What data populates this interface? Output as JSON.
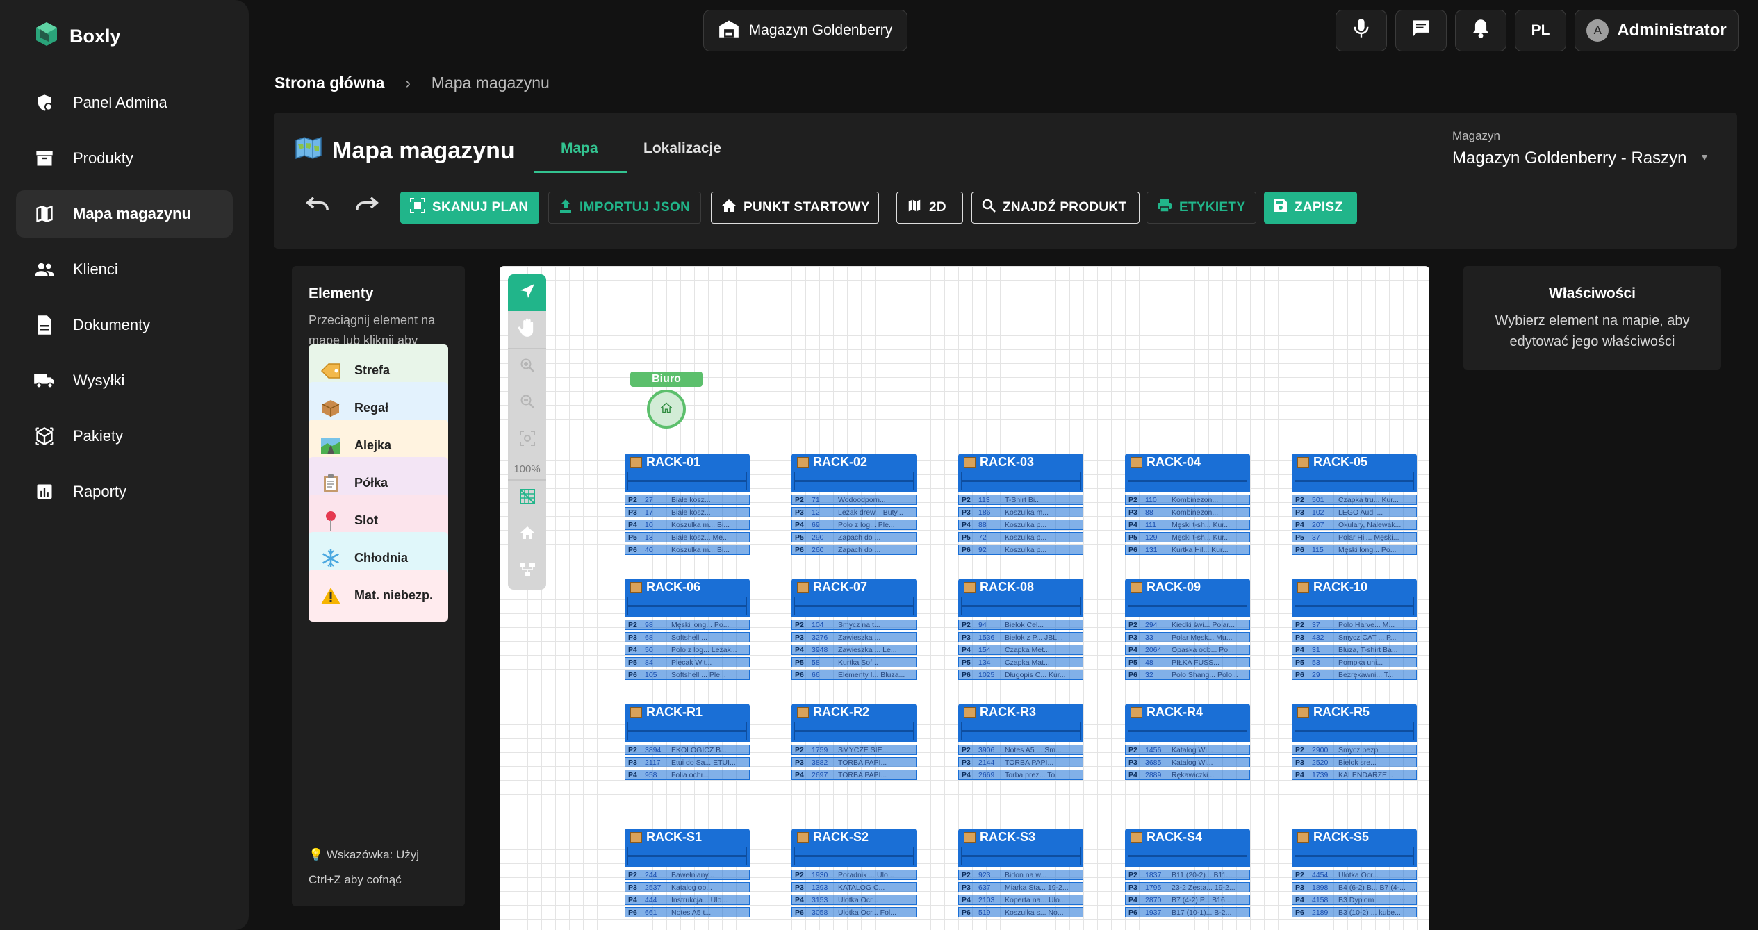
{
  "app": {
    "name": "Boxly"
  },
  "sidebar": {
    "items": [
      {
        "label": "Panel Admina",
        "icon": "admin-shield-icon"
      },
      {
        "label": "Produkty",
        "icon": "archive-box-icon"
      },
      {
        "label": "Mapa magazynu",
        "icon": "map-icon",
        "active": true
      },
      {
        "label": "Klienci",
        "icon": "people-icon"
      },
      {
        "label": "Dokumenty",
        "icon": "document-icon"
      },
      {
        "label": "Wysyłki",
        "icon": "truck-icon"
      },
      {
        "label": "Pakiety",
        "icon": "package-icon"
      },
      {
        "label": "Raporty",
        "icon": "chart-icon"
      }
    ]
  },
  "topbar": {
    "warehouse": "Magazyn Goldenberry",
    "language": "PL",
    "user_initial": "A",
    "user_name": "Administrator"
  },
  "breadcrumb": {
    "home": "Strona główna",
    "current": "Mapa magazynu"
  },
  "header": {
    "title": "Mapa magazynu",
    "tabs": [
      {
        "label": "Mapa",
        "active": true
      },
      {
        "label": "Lokalizacje",
        "active": false
      }
    ],
    "warehouse_select": {
      "label": "Magazyn",
      "value": "Magazyn Goldenberry - Raszyn"
    }
  },
  "toolbar": {
    "scan": "SKANUJ PLAN",
    "import": "IMPORTUJ JSON",
    "start": "PUNKT STARTOWY",
    "view": "2D",
    "find": "ZNAJDŹ PRODUKT",
    "labels": "ETYKIETY",
    "save": "ZAPISZ"
  },
  "elements_panel": {
    "title": "Elementy",
    "description": "Przeciągnij element na mapę lub kliknij aby dodać",
    "items": [
      {
        "label": "Strefa",
        "bg": "#e8f5e9",
        "icon": "tag-icon"
      },
      {
        "label": "Regał",
        "bg": "#e3f2fd",
        "icon": "box-icon"
      },
      {
        "label": "Alejka",
        "bg": "#fff3e0",
        "icon": "road-icon"
      },
      {
        "label": "Półka",
        "bg": "#f3e5f5",
        "icon": "clipboard-icon"
      },
      {
        "label": "Slot",
        "bg": "#fce4ec",
        "icon": "pin-icon"
      },
      {
        "label": "Chłodnia",
        "bg": "#e0f7fa",
        "icon": "snowflake-icon"
      },
      {
        "label": "Mat. niebezp.",
        "bg": "#ffebee",
        "icon": "warning-icon"
      }
    ],
    "hint": "💡 Wskazówka: Użyj Ctrl+Z aby cofnąć"
  },
  "map": {
    "zoom": "100%",
    "office_label": "Biuro",
    "racks": [
      {
        "name": "RACK-01",
        "rows": [
          [
            "P2",
            "27",
            "Białe kosz..."
          ],
          [
            "P3",
            "17",
            "Białe kosz..."
          ],
          [
            "P4",
            "10",
            "Koszulka m... Bi..."
          ],
          [
            "P5",
            "13",
            "Białe kosz... Me..."
          ],
          [
            "P6",
            "40",
            "Koszulka m... Bi..."
          ]
        ]
      },
      {
        "name": "RACK-02",
        "rows": [
          [
            "P2",
            "71",
            "Wodoodporn..."
          ],
          [
            "P3",
            "12",
            "Lezak drew... Buty..."
          ],
          [
            "P4",
            "69",
            "Polo z log... Ple..."
          ],
          [
            "P5",
            "290",
            "Zapach do ..."
          ],
          [
            "P6",
            "260",
            "Zapach do ..."
          ]
        ]
      },
      {
        "name": "RACK-03",
        "rows": [
          [
            "P2",
            "113",
            "T-Shirt Bi..."
          ],
          [
            "P3",
            "186",
            "Koszulka m..."
          ],
          [
            "P4",
            "88",
            "Koszulka p..."
          ],
          [
            "P5",
            "72",
            "Koszulka p..."
          ],
          [
            "P6",
            "92",
            "Koszulka p..."
          ]
        ]
      },
      {
        "name": "RACK-04",
        "rows": [
          [
            "P2",
            "110",
            "Kombinezon..."
          ],
          [
            "P3",
            "88",
            "Kombinezon..."
          ],
          [
            "P4",
            "111",
            "Męski t-sh... Kur..."
          ],
          [
            "P5",
            "129",
            "Męski t-sh... Kur..."
          ],
          [
            "P6",
            "131",
            "Kurtka Hil... Kur..."
          ]
        ]
      },
      {
        "name": "RACK-05",
        "rows": [
          [
            "P2",
            "501",
            "Czapka tru... Kur..."
          ],
          [
            "P3",
            "102",
            "LEGO Audi ..."
          ],
          [
            "P4",
            "207",
            "Okulary, Nalewak..."
          ],
          [
            "P5",
            "37",
            "Polar Hil... Męski..."
          ],
          [
            "P6",
            "115",
            "Męski long... Po..."
          ]
        ]
      },
      {
        "name": "RACK-06",
        "rows": [
          [
            "P2",
            "98",
            "Męski long... Po..."
          ],
          [
            "P3",
            "68",
            "Softshell ..."
          ],
          [
            "P4",
            "50",
            "Polo z log... Leżak..."
          ],
          [
            "P5",
            "84",
            "Plecak Wit..."
          ],
          [
            "P6",
            "105",
            "Softshell ... Ple..."
          ]
        ]
      },
      {
        "name": "RACK-07",
        "rows": [
          [
            "P2",
            "104",
            "Smycz na t..."
          ],
          [
            "P3",
            "3276",
            "Zawieszka ..."
          ],
          [
            "P4",
            "3948",
            "Zawieszka ... Le..."
          ],
          [
            "P5",
            "58",
            "Kurtka Sof..."
          ],
          [
            "P6",
            "66",
            "Elementy I... Bluza..."
          ]
        ]
      },
      {
        "name": "RACK-08",
        "rows": [
          [
            "P2",
            "94",
            "Bielok Cel..."
          ],
          [
            "P3",
            "1536",
            "Bielok z P... JBL..."
          ],
          [
            "P4",
            "154",
            "Czapka Met..."
          ],
          [
            "P5",
            "134",
            "Czapka Mat..."
          ],
          [
            "P6",
            "1025",
            "Długopis C... Kur..."
          ]
        ]
      },
      {
        "name": "RACK-09",
        "rows": [
          [
            "P2",
            "294",
            "Kiedki świ... Polar..."
          ],
          [
            "P3",
            "33",
            "Polar Męsk... Mu..."
          ],
          [
            "P4",
            "2064",
            "Opaska odb... Po..."
          ],
          [
            "P5",
            "48",
            "PIŁKA FUSS..."
          ],
          [
            "P6",
            "32",
            "Polo Shang... Polo..."
          ]
        ]
      },
      {
        "name": "RACK-10",
        "rows": [
          [
            "P2",
            "37",
            "Polo Harve... M..."
          ],
          [
            "P3",
            "432",
            "Smycz CAT ... P..."
          ],
          [
            "P4",
            "31",
            "Bluza, T-shirt Ba..."
          ],
          [
            "P5",
            "53",
            "Pompka uni..."
          ],
          [
            "P6",
            "29",
            "Bezrękawni... T..."
          ]
        ]
      },
      {
        "name": "RACK-R1",
        "rows": [
          [
            "P2",
            "3894",
            "EKOLOGICZ B..."
          ],
          [
            "P3",
            "2117",
            "Etui do Sa... ETUI..."
          ],
          [
            "P4",
            "958",
            "Folia ochr..."
          ]
        ]
      },
      {
        "name": "RACK-R2",
        "rows": [
          [
            "P2",
            "1759",
            "SMYCZE SIE..."
          ],
          [
            "P3",
            "3882",
            "TORBA PAPI..."
          ],
          [
            "P4",
            "2697",
            "TORBA PAPI..."
          ]
        ]
      },
      {
        "name": "RACK-R3",
        "rows": [
          [
            "P2",
            "3906",
            "Notes A5 ... Sm..."
          ],
          [
            "P3",
            "2144",
            "TORBA PAPI..."
          ],
          [
            "P4",
            "2669",
            "Torba prez... To..."
          ]
        ]
      },
      {
        "name": "RACK-R4",
        "rows": [
          [
            "P2",
            "1456",
            "Katalog Wi..."
          ],
          [
            "P3",
            "3685",
            "Katalog Wi..."
          ],
          [
            "P4",
            "2889",
            "Rękawiczki..."
          ]
        ]
      },
      {
        "name": "RACK-R5",
        "rows": [
          [
            "P2",
            "2900",
            "Smycz bezp..."
          ],
          [
            "P3",
            "2520",
            "Bielok sre..."
          ],
          [
            "P4",
            "1739",
            "KALENDARZE..."
          ]
        ]
      },
      {
        "name": "RACK-S1",
        "rows": [
          [
            "P2",
            "244",
            "Bawełniany..."
          ],
          [
            "P3",
            "2537",
            "Katalog ob..."
          ],
          [
            "P4",
            "444",
            "Instrukcja... Ulo..."
          ],
          [
            "P6",
            "661",
            "Notes A5 t..."
          ]
        ]
      },
      {
        "name": "RACK-S2",
        "rows": [
          [
            "P2",
            "1930",
            "Poradnik ... Ulo..."
          ],
          [
            "P3",
            "1393",
            "KATALOG C..."
          ],
          [
            "P4",
            "3153",
            "Ulotka Ocr..."
          ],
          [
            "P6",
            "3058",
            "Ulotka Ocr... Fol..."
          ]
        ]
      },
      {
        "name": "RACK-S3",
        "rows": [
          [
            "P2",
            "923",
            "Bidon na w..."
          ],
          [
            "P3",
            "637",
            "Miarka Sta... 19-2..."
          ],
          [
            "P4",
            "2103",
            "Koperta na... Ulo..."
          ],
          [
            "P6",
            "519",
            "Koszulka s... No..."
          ]
        ]
      },
      {
        "name": "RACK-S4",
        "rows": [
          [
            "P2",
            "1837",
            "B11 (20-2)... B11..."
          ],
          [
            "P3",
            "1795",
            "23-2 Zesta... 19-2..."
          ],
          [
            "P4",
            "2870",
            "B7 (4-2) P... B16..."
          ],
          [
            "P6",
            "1937",
            "B17 (10-1)... B-2..."
          ]
        ]
      },
      {
        "name": "RACK-S5",
        "rows": [
          [
            "P2",
            "4454",
            "Ulotka Ocr..."
          ],
          [
            "P3",
            "1898",
            "B4 (6-2) B... B7 (4-..."
          ],
          [
            "P4",
            "4158",
            "B3 Dyplom ..."
          ],
          [
            "P6",
            "2189",
            "B3 (10-2) ... kube..."
          ]
        ]
      }
    ]
  },
  "properties": {
    "title": "Właściwości",
    "description": "Wybierz element na mapie, aby edytować jego właściwości"
  },
  "colors": {
    "accent": "#21b58a",
    "rack": "#1a6fd6",
    "office": "#5cbf6c"
  }
}
